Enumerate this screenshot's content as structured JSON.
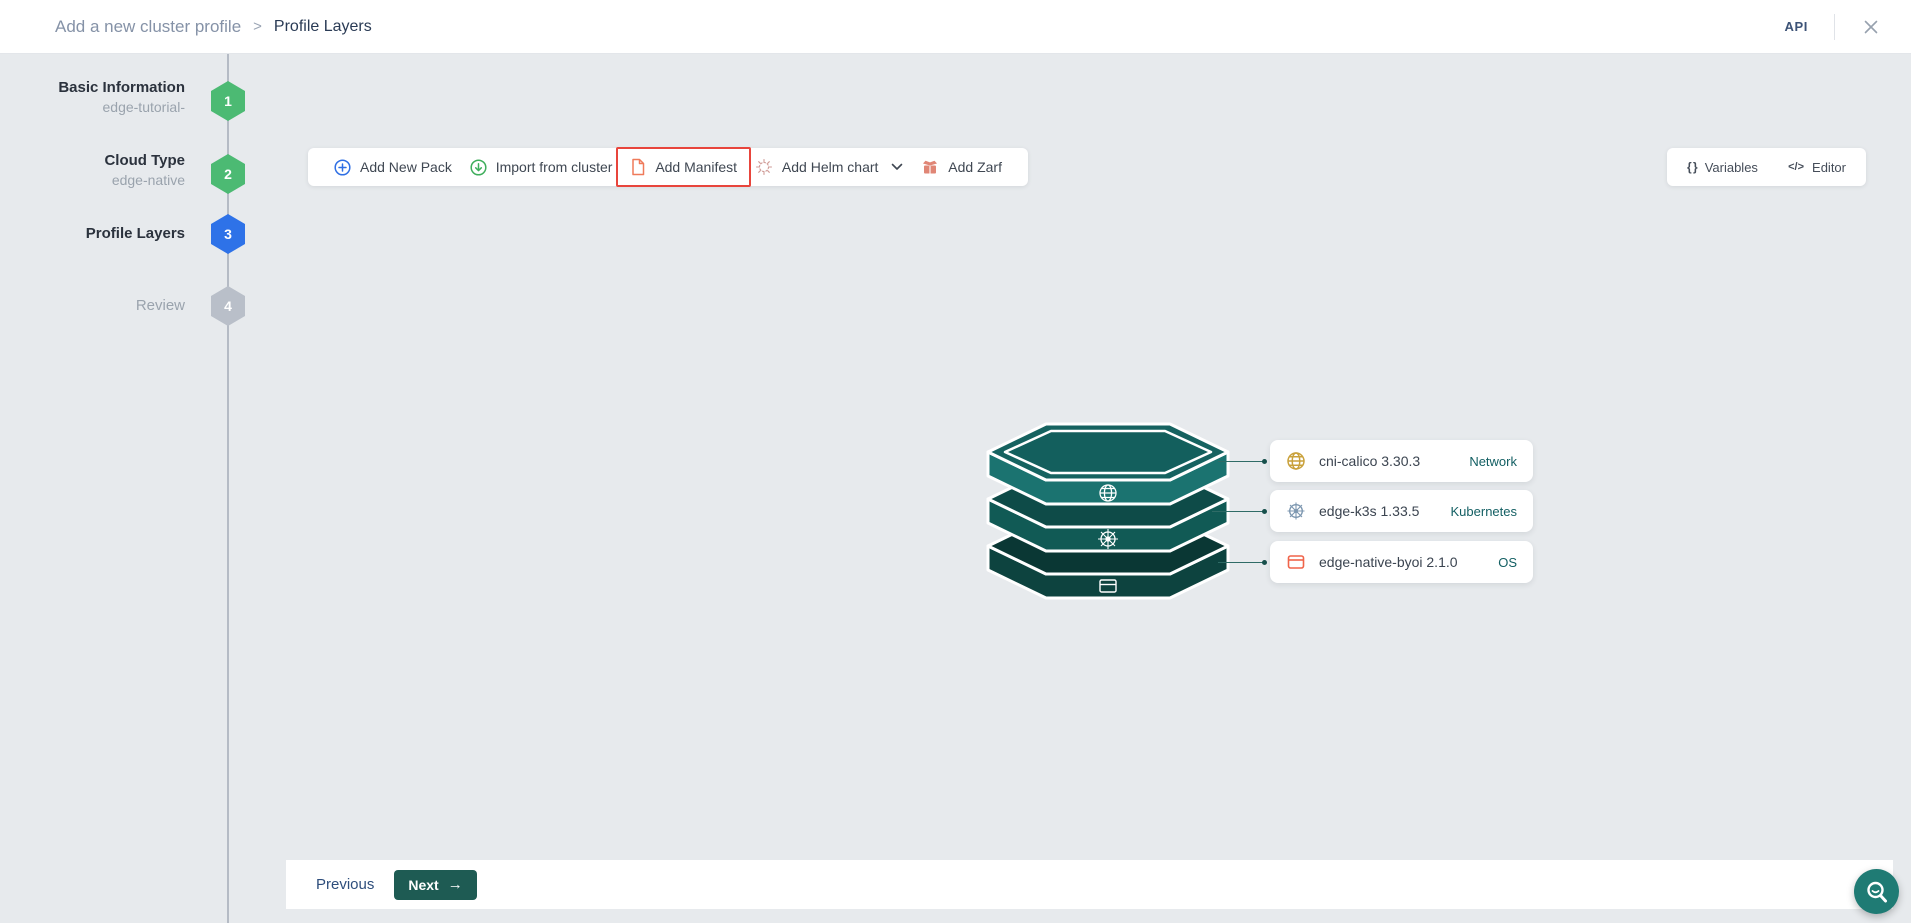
{
  "header": {
    "breadcrumb_parent": "Add a new cluster profile",
    "separator": ">",
    "title": "Profile Layers",
    "api": "API"
  },
  "stepper": {
    "steps": [
      {
        "number": "1",
        "label": "Basic Information",
        "sublabel": "edge-tutorial-",
        "state": "done"
      },
      {
        "number": "2",
        "label": "Cloud Type",
        "sublabel": "edge-native",
        "state": "done"
      },
      {
        "number": "3",
        "label": "Profile Layers",
        "sublabel": "",
        "state": "active"
      },
      {
        "number": "4",
        "label": "Review",
        "sublabel": "",
        "state": "pending"
      }
    ]
  },
  "toolbar": {
    "items": [
      {
        "label": "Add New Pack",
        "icon": "circle-plus"
      },
      {
        "label": "Import from cluster",
        "icon": "circle-arrow-down"
      },
      {
        "label": "Add Manifest",
        "icon": "manifest-file",
        "highlighted": true
      },
      {
        "label": "Add Helm chart",
        "icon": "helm-wheel",
        "has_dropdown": true
      },
      {
        "label": "Add Zarf",
        "icon": "zarf-package"
      }
    ]
  },
  "side_tools": {
    "variables_icon": "{ }",
    "variables": "Variables",
    "editor_icon": "</>",
    "editor": "Editor"
  },
  "profile_stack": {
    "cards": [
      {
        "name": "cni-calico 3.30.3",
        "tag": "Network",
        "icon": "globe"
      },
      {
        "name": "edge-k3s 1.33.5",
        "tag": "Kubernetes",
        "icon": "helm-wheel"
      },
      {
        "name": "edge-native-byoi 2.1.0",
        "tag": "OS",
        "icon": "os-window"
      }
    ],
    "layer_icons": [
      "globe",
      "kubernetes-wheel",
      "os-window"
    ]
  },
  "footer": {
    "previous": "Previous",
    "next": "Next",
    "next_arrow": "→"
  },
  "icons": {
    "close": "x-cross",
    "chevron": "chevron-down",
    "beacon": "magnifier-smile"
  },
  "colors": {
    "background": "#e7eaed",
    "step_done": "#4cba73",
    "step_active": "#2e72e8",
    "step_pending": "#b9bfc9",
    "highlight_red": "#e8453c",
    "layer_top_teal": "#166260",
    "layer_mid_teal": "#0e4b48",
    "layer_bottom_teal": "#0a3734",
    "next_button": "#1e5b53",
    "beacon_teal": "#1f7b74",
    "tag_teal": "#135f63",
    "pack_blue": "#2f6fe4",
    "import_green": "#3fae5c",
    "manifest_orange": "#ef7a5a",
    "helm_pink": "#cf9a96",
    "zarf_salmon": "#e08676",
    "globe_gold": "#c9a13b",
    "k8s_steel": "#7d97b0",
    "os_orange": "#f0644a"
  }
}
